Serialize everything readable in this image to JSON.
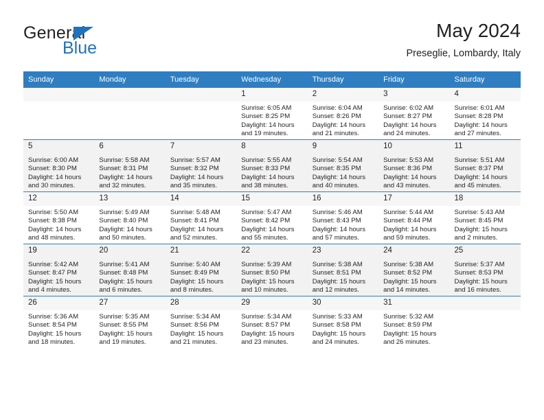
{
  "brand": {
    "name_part1": "General",
    "name_part2": "Blue",
    "triangle_color": "#1f72bd",
    "text_color": "#231f20"
  },
  "header": {
    "title": "May 2024",
    "subtitle": "Preseglie, Lombardy, Italy"
  },
  "theme": {
    "header_row_bg": "#2f7ec1",
    "header_row_text": "#ffffff",
    "row_alt_bg": "#f2f2f2",
    "grid_line": "#2f7ec1"
  },
  "weekdays": [
    "Sunday",
    "Monday",
    "Tuesday",
    "Wednesday",
    "Thursday",
    "Friday",
    "Saturday"
  ],
  "weeks": [
    [
      {
        "day": "",
        "sunrise": "",
        "sunset": "",
        "daylight": ""
      },
      {
        "day": "",
        "sunrise": "",
        "sunset": "",
        "daylight": ""
      },
      {
        "day": "",
        "sunrise": "",
        "sunset": "",
        "daylight": ""
      },
      {
        "day": "1",
        "sunrise": "Sunrise: 6:05 AM",
        "sunset": "Sunset: 8:25 PM",
        "daylight": "Daylight: 14 hours and 19 minutes."
      },
      {
        "day": "2",
        "sunrise": "Sunrise: 6:04 AM",
        "sunset": "Sunset: 8:26 PM",
        "daylight": "Daylight: 14 hours and 21 minutes."
      },
      {
        "day": "3",
        "sunrise": "Sunrise: 6:02 AM",
        "sunset": "Sunset: 8:27 PM",
        "daylight": "Daylight: 14 hours and 24 minutes."
      },
      {
        "day": "4",
        "sunrise": "Sunrise: 6:01 AM",
        "sunset": "Sunset: 8:28 PM",
        "daylight": "Daylight: 14 hours and 27 minutes."
      }
    ],
    [
      {
        "day": "5",
        "sunrise": "Sunrise: 6:00 AM",
        "sunset": "Sunset: 8:30 PM",
        "daylight": "Daylight: 14 hours and 30 minutes."
      },
      {
        "day": "6",
        "sunrise": "Sunrise: 5:58 AM",
        "sunset": "Sunset: 8:31 PM",
        "daylight": "Daylight: 14 hours and 32 minutes."
      },
      {
        "day": "7",
        "sunrise": "Sunrise: 5:57 AM",
        "sunset": "Sunset: 8:32 PM",
        "daylight": "Daylight: 14 hours and 35 minutes."
      },
      {
        "day": "8",
        "sunrise": "Sunrise: 5:55 AM",
        "sunset": "Sunset: 8:33 PM",
        "daylight": "Daylight: 14 hours and 38 minutes."
      },
      {
        "day": "9",
        "sunrise": "Sunrise: 5:54 AM",
        "sunset": "Sunset: 8:35 PM",
        "daylight": "Daylight: 14 hours and 40 minutes."
      },
      {
        "day": "10",
        "sunrise": "Sunrise: 5:53 AM",
        "sunset": "Sunset: 8:36 PM",
        "daylight": "Daylight: 14 hours and 43 minutes."
      },
      {
        "day": "11",
        "sunrise": "Sunrise: 5:51 AM",
        "sunset": "Sunset: 8:37 PM",
        "daylight": "Daylight: 14 hours and 45 minutes."
      }
    ],
    [
      {
        "day": "12",
        "sunrise": "Sunrise: 5:50 AM",
        "sunset": "Sunset: 8:38 PM",
        "daylight": "Daylight: 14 hours and 48 minutes."
      },
      {
        "day": "13",
        "sunrise": "Sunrise: 5:49 AM",
        "sunset": "Sunset: 8:40 PM",
        "daylight": "Daylight: 14 hours and 50 minutes."
      },
      {
        "day": "14",
        "sunrise": "Sunrise: 5:48 AM",
        "sunset": "Sunset: 8:41 PM",
        "daylight": "Daylight: 14 hours and 52 minutes."
      },
      {
        "day": "15",
        "sunrise": "Sunrise: 5:47 AM",
        "sunset": "Sunset: 8:42 PM",
        "daylight": "Daylight: 14 hours and 55 minutes."
      },
      {
        "day": "16",
        "sunrise": "Sunrise: 5:46 AM",
        "sunset": "Sunset: 8:43 PM",
        "daylight": "Daylight: 14 hours and 57 minutes."
      },
      {
        "day": "17",
        "sunrise": "Sunrise: 5:44 AM",
        "sunset": "Sunset: 8:44 PM",
        "daylight": "Daylight: 14 hours and 59 minutes."
      },
      {
        "day": "18",
        "sunrise": "Sunrise: 5:43 AM",
        "sunset": "Sunset: 8:45 PM",
        "daylight": "Daylight: 15 hours and 2 minutes."
      }
    ],
    [
      {
        "day": "19",
        "sunrise": "Sunrise: 5:42 AM",
        "sunset": "Sunset: 8:47 PM",
        "daylight": "Daylight: 15 hours and 4 minutes."
      },
      {
        "day": "20",
        "sunrise": "Sunrise: 5:41 AM",
        "sunset": "Sunset: 8:48 PM",
        "daylight": "Daylight: 15 hours and 6 minutes."
      },
      {
        "day": "21",
        "sunrise": "Sunrise: 5:40 AM",
        "sunset": "Sunset: 8:49 PM",
        "daylight": "Daylight: 15 hours and 8 minutes."
      },
      {
        "day": "22",
        "sunrise": "Sunrise: 5:39 AM",
        "sunset": "Sunset: 8:50 PM",
        "daylight": "Daylight: 15 hours and 10 minutes."
      },
      {
        "day": "23",
        "sunrise": "Sunrise: 5:38 AM",
        "sunset": "Sunset: 8:51 PM",
        "daylight": "Daylight: 15 hours and 12 minutes."
      },
      {
        "day": "24",
        "sunrise": "Sunrise: 5:38 AM",
        "sunset": "Sunset: 8:52 PM",
        "daylight": "Daylight: 15 hours and 14 minutes."
      },
      {
        "day": "25",
        "sunrise": "Sunrise: 5:37 AM",
        "sunset": "Sunset: 8:53 PM",
        "daylight": "Daylight: 15 hours and 16 minutes."
      }
    ],
    [
      {
        "day": "26",
        "sunrise": "Sunrise: 5:36 AM",
        "sunset": "Sunset: 8:54 PM",
        "daylight": "Daylight: 15 hours and 18 minutes."
      },
      {
        "day": "27",
        "sunrise": "Sunrise: 5:35 AM",
        "sunset": "Sunset: 8:55 PM",
        "daylight": "Daylight: 15 hours and 19 minutes."
      },
      {
        "day": "28",
        "sunrise": "Sunrise: 5:34 AM",
        "sunset": "Sunset: 8:56 PM",
        "daylight": "Daylight: 15 hours and 21 minutes."
      },
      {
        "day": "29",
        "sunrise": "Sunrise: 5:34 AM",
        "sunset": "Sunset: 8:57 PM",
        "daylight": "Daylight: 15 hours and 23 minutes."
      },
      {
        "day": "30",
        "sunrise": "Sunrise: 5:33 AM",
        "sunset": "Sunset: 8:58 PM",
        "daylight": "Daylight: 15 hours and 24 minutes."
      },
      {
        "day": "31",
        "sunrise": "Sunrise: 5:32 AM",
        "sunset": "Sunset: 8:59 PM",
        "daylight": "Daylight: 15 hours and 26 minutes."
      },
      {
        "day": "",
        "sunrise": "",
        "sunset": "",
        "daylight": ""
      }
    ]
  ]
}
